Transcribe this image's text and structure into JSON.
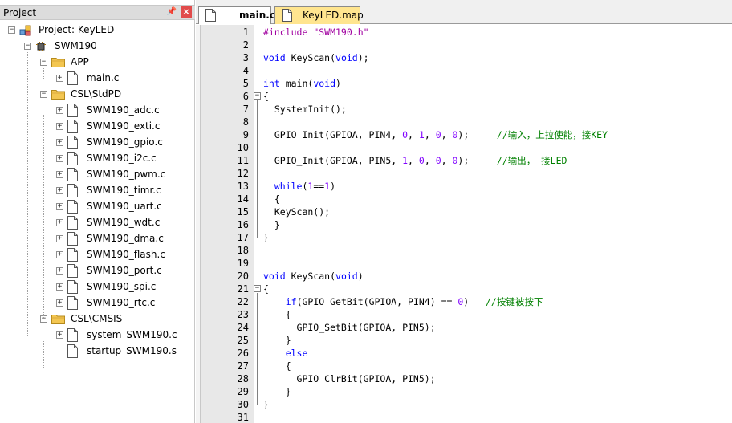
{
  "project_panel": {
    "title": "Project",
    "pin_icon": "pin-icon",
    "close_icon": "close-icon",
    "tree": [
      {
        "label": "Project: KeyLED",
        "type": "project",
        "icon": "project-icon",
        "expanded": true
      },
      {
        "label": "SWM190",
        "type": "target",
        "icon": "chip-icon",
        "expanded": true
      },
      {
        "label": "APP",
        "type": "group",
        "icon": "folder-icon",
        "expanded": true
      },
      {
        "label": "main.c",
        "type": "file",
        "icon": "file-icon"
      },
      {
        "label": "CSL\\StdPD",
        "type": "group",
        "icon": "folder-icon",
        "expanded": true
      },
      {
        "label": "SWM190_adc.c",
        "type": "file",
        "icon": "file-icon"
      },
      {
        "label": "SWM190_exti.c",
        "type": "file",
        "icon": "file-icon"
      },
      {
        "label": "SWM190_gpio.c",
        "type": "file",
        "icon": "file-icon"
      },
      {
        "label": "SWM190_i2c.c",
        "type": "file",
        "icon": "file-icon"
      },
      {
        "label": "SWM190_pwm.c",
        "type": "file",
        "icon": "file-icon"
      },
      {
        "label": "SWM190_timr.c",
        "type": "file",
        "icon": "file-icon"
      },
      {
        "label": "SWM190_uart.c",
        "type": "file",
        "icon": "file-icon"
      },
      {
        "label": "SWM190_wdt.c",
        "type": "file",
        "icon": "file-icon"
      },
      {
        "label": "SWM190_dma.c",
        "type": "file",
        "icon": "file-icon"
      },
      {
        "label": "SWM190_flash.c",
        "type": "file",
        "icon": "file-icon"
      },
      {
        "label": "SWM190_port.c",
        "type": "file",
        "icon": "file-icon"
      },
      {
        "label": "SWM190_spi.c",
        "type": "file",
        "icon": "file-icon"
      },
      {
        "label": "SWM190_rtc.c",
        "type": "file",
        "icon": "file-icon"
      },
      {
        "label": "CSL\\CMSIS",
        "type": "group",
        "icon": "folder-icon",
        "expanded": true
      },
      {
        "label": "system_SWM190.c",
        "type": "file",
        "icon": "file-icon"
      },
      {
        "label": "startup_SWM190.s",
        "type": "file",
        "icon": "file-icon"
      }
    ]
  },
  "editor": {
    "tabs": [
      {
        "label": "main.c",
        "active": true,
        "icon": "file-icon"
      },
      {
        "label": "KeyLED.map",
        "active": false,
        "icon": "file-icon"
      }
    ],
    "lines": [
      {
        "n": "1",
        "text": "#include \"SWM190.h\""
      },
      {
        "n": "2",
        "text": ""
      },
      {
        "n": "3",
        "text": "void KeyScan(void);"
      },
      {
        "n": "4",
        "text": ""
      },
      {
        "n": "5",
        "text": "int main(void)"
      },
      {
        "n": "6",
        "text": "{"
      },
      {
        "n": "7",
        "text": "  SystemInit();"
      },
      {
        "n": "8",
        "text": ""
      },
      {
        "n": "9",
        "text": "  GPIO_Init(GPIOA, PIN4, 0, 1, 0, 0);     //输入，上拉使能，接KEY"
      },
      {
        "n": "10",
        "text": ""
      },
      {
        "n": "11",
        "text": "  GPIO_Init(GPIOA, PIN5, 1, 0, 0, 0);     //输出， 接LED"
      },
      {
        "n": "12",
        "text": ""
      },
      {
        "n": "13",
        "text": "  while(1==1)"
      },
      {
        "n": "14",
        "text": "  {"
      },
      {
        "n": "15",
        "text": "  KeyScan();"
      },
      {
        "n": "16",
        "text": "  }"
      },
      {
        "n": "17",
        "text": "}"
      },
      {
        "n": "18",
        "text": ""
      },
      {
        "n": "19",
        "text": ""
      },
      {
        "n": "20",
        "text": "void KeyScan(void)"
      },
      {
        "n": "21",
        "text": "{"
      },
      {
        "n": "22",
        "text": "    if(GPIO_GetBit(GPIOA, PIN4) == 0)   //按键被按下"
      },
      {
        "n": "23",
        "text": "    {"
      },
      {
        "n": "24",
        "text": "      GPIO_SetBit(GPIOA, PIN5);"
      },
      {
        "n": "25",
        "text": "    }"
      },
      {
        "n": "26",
        "text": "    else"
      },
      {
        "n": "27",
        "text": "    {"
      },
      {
        "n": "28",
        "text": "      GPIO_ClrBit(GPIOA, PIN5);"
      },
      {
        "n": "29",
        "text": "    }"
      },
      {
        "n": "30",
        "text": "}"
      },
      {
        "n": "31",
        "text": ""
      }
    ]
  },
  "colors": {
    "keyword": "#0000ff",
    "number": "#8000ff",
    "string": "#a000a0",
    "comment": "#008000",
    "active_tab_inactive_bg": "#ffe58f",
    "gutter_bg": "#e8e8e8"
  }
}
